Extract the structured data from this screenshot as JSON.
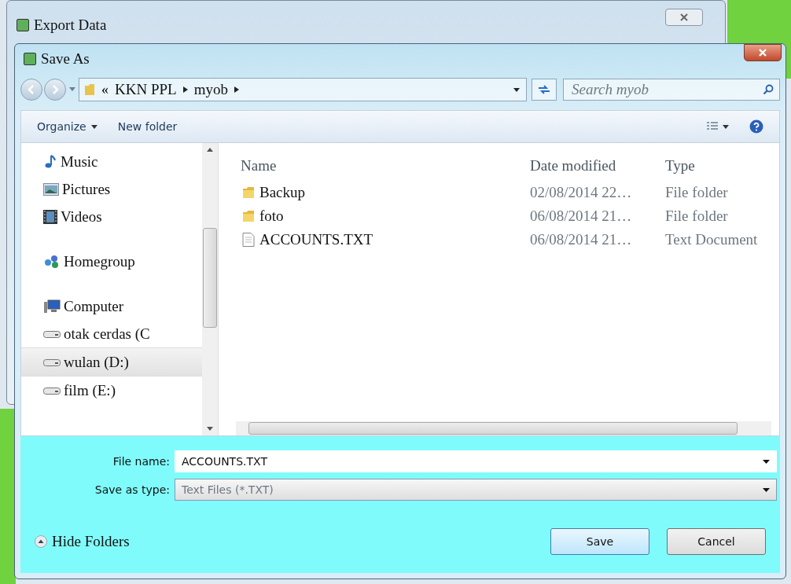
{
  "background_window": {
    "title": "Export Data"
  },
  "dialog": {
    "title": "Save As"
  },
  "address_bar": {
    "overflow": "«",
    "crumbs": [
      "KKN PPL",
      "myob"
    ]
  },
  "search": {
    "placeholder": "Search myob"
  },
  "toolbar": {
    "organize": "Organize",
    "new_folder": "New folder"
  },
  "nav": [
    {
      "label": "Music",
      "kind": "music",
      "selected": false
    },
    {
      "label": "Pictures",
      "kind": "pictures",
      "selected": false
    },
    {
      "label": "Videos",
      "kind": "videos",
      "selected": false
    },
    {
      "label": "Homegroup",
      "kind": "homegroup",
      "selected": false
    },
    {
      "label": "Computer",
      "kind": "computer",
      "selected": false
    },
    {
      "label": "otak cerdas (C",
      "kind": "drive",
      "selected": false
    },
    {
      "label": "wulan (D:)",
      "kind": "drive",
      "selected": true
    },
    {
      "label": "film (E:)",
      "kind": "drive",
      "selected": false
    }
  ],
  "columns": [
    "Name",
    "Date modified",
    "Type"
  ],
  "files": [
    {
      "name": "Backup",
      "kind": "folder",
      "date": "02/08/2014 22…",
      "type": "File folder"
    },
    {
      "name": "foto",
      "kind": "folder",
      "date": "06/08/2014 21…",
      "type": "File folder"
    },
    {
      "name": "ACCOUNTS.TXT",
      "kind": "text",
      "date": "06/08/2014 21…",
      "type": "Text Document"
    }
  ],
  "file_name": {
    "label": "File name:",
    "value": "ACCOUNTS.TXT"
  },
  "save_type": {
    "label": "Save as type:",
    "value": "Text Files (*.TXT)"
  },
  "hide_folders": "Hide Folders",
  "buttons": [
    "Save",
    "Cancel"
  ]
}
